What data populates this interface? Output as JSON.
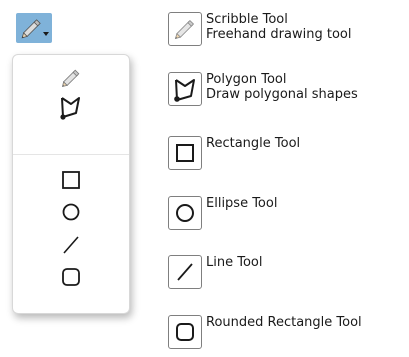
{
  "tools": [
    {
      "icon": "pencil-icon",
      "name": "Scribble Tool",
      "description": "Freehand drawing tool"
    },
    {
      "icon": "polygon-icon",
      "name": "Polygon Tool",
      "description": "Draw polygonal shapes"
    },
    {
      "icon": "rectangle-icon",
      "name": "Rectangle Tool"
    },
    {
      "icon": "ellipse-icon",
      "name": "Ellipse Tool"
    },
    {
      "icon": "line-icon",
      "name": "Line Tool"
    },
    {
      "icon": "rounded-rectangle-icon",
      "name": "Rounded Rectangle Tool"
    }
  ],
  "colors": {
    "trigger_bg": "#7fb2d9",
    "icon_stroke": "#1a1a1a"
  }
}
